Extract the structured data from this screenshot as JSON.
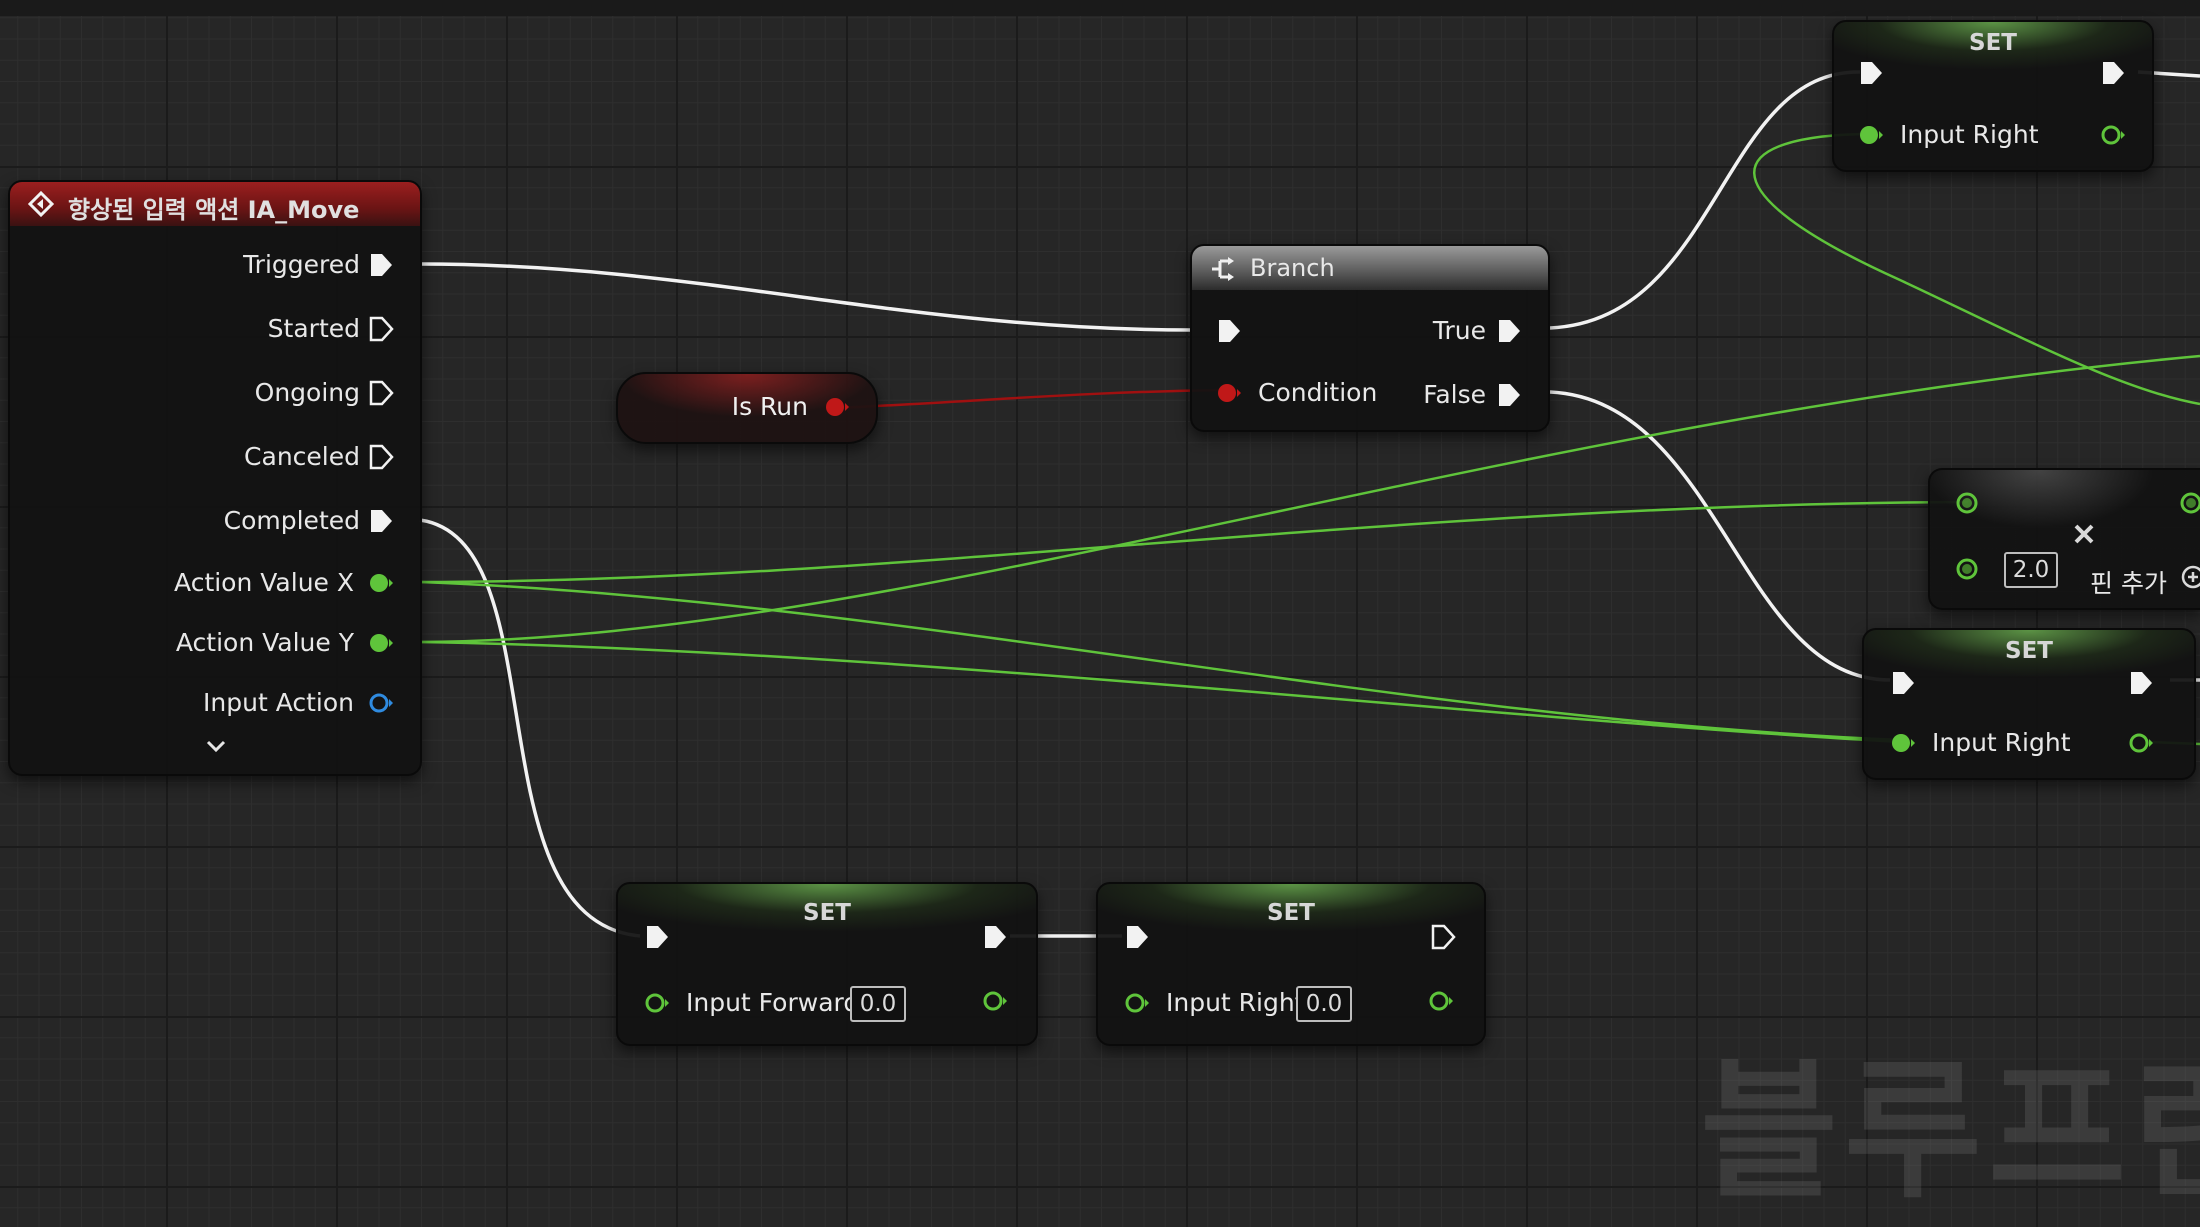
{
  "graph": {
    "watermark": "블루프린트"
  },
  "event_node": {
    "title": "향상된 입력 액션 IA_Move",
    "header_color": "#8a1a1a",
    "outputs": [
      "Triggered",
      "Started",
      "Ongoing",
      "Canceled",
      "Completed"
    ],
    "data_outputs": [
      "Action Value X",
      "Action Value Y",
      "Input Action"
    ],
    "expand_icon": "chevron-down-icon"
  },
  "is_run_node": {
    "label": "Is Run",
    "pin_color": "#c01818"
  },
  "branch_node": {
    "title": "Branch",
    "icon": "branch-icon",
    "input_label": "Condition",
    "true_label": "True",
    "false_label": "False"
  },
  "set_top": {
    "title": "SET",
    "variable": "Input Right"
  },
  "math_node": {
    "value": "2.0",
    "add_pin_label": "핀 추가",
    "close_icon": "x-icon"
  },
  "set_mid": {
    "title": "SET",
    "variable": "Input Right"
  },
  "set_forward": {
    "title": "SET",
    "variable": "Input Forward",
    "value": "0.0"
  },
  "set_right_bottom": {
    "title": "SET",
    "variable": "Input Right",
    "value": "0.0"
  },
  "colors": {
    "float_pin": "#5fc43b",
    "struct_pin": "#2f8be0",
    "bool_pin": "#c01818",
    "exec_wire": "#f0f0f0"
  }
}
